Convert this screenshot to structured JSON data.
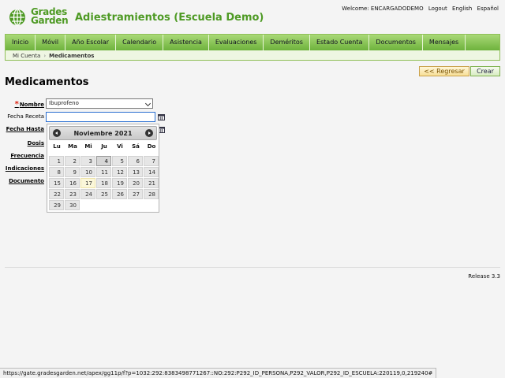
{
  "app": {
    "logo_line1": "Grades",
    "logo_line2": "Garden",
    "title": "Adiestramientos (Escuela Demo)"
  },
  "top_links": {
    "welcome": "Welcome: ENCARGADODEMO",
    "logout": "Logout",
    "english": "English",
    "spanish": "Español"
  },
  "nav": {
    "tabs": [
      "Inicio",
      "Móvil",
      "Año Escolar",
      "Calendario",
      "Asistencia",
      "Evaluaciones",
      "Deméritos",
      "Estado Cuenta",
      "Documentos",
      "Mensajes"
    ]
  },
  "breadcrumb": {
    "parent": "Mi Cuenta",
    "separator": "›",
    "current": "Medicamentos"
  },
  "page": {
    "title": "Medicamentos",
    "back_label": "<< Regresar",
    "create_label": "Crear"
  },
  "form": {
    "required_mark": "*",
    "nombre_label": "Nombre",
    "nombre_value": "Ibuprofeno",
    "fecha_receta_label": "Fecha Receta",
    "fecha_receta_value": "",
    "fecha_hasta_label": "Fecha Hasta",
    "dosis_label": "Dosis",
    "frecuencia_label": "Frecuencia",
    "indicaciones_label": "Indicaciones",
    "documento_label": "Documento"
  },
  "datepicker": {
    "title": "Noviembre 2021",
    "dows": [
      "Lu",
      "Ma",
      "Mi",
      "Ju",
      "Vi",
      "Sá",
      "Do"
    ],
    "first_dow_index": 0,
    "days_in_month": 30,
    "active_day": 4,
    "today_day": 17
  },
  "footer": {
    "release": "Release 3.3"
  },
  "statusbar": {
    "url": "https://gate.gradesgarden.net/apex/gg11p/f?p=1032:292:8383498771267::NO:292:P292_ID_PERSONA,P292_VALOR,P292_ID_ESCUELA:220119,0,219240#"
  },
  "colors": {
    "brand_green": "#4e9a24",
    "nav_green": "#6db23c",
    "required_red": "#d21111",
    "input_focus_blue": "#2a6fd1"
  },
  "icons": [
    "logo-icon",
    "calendar-icon",
    "chevron-down-icon",
    "prev-month-icon",
    "next-month-icon"
  ]
}
